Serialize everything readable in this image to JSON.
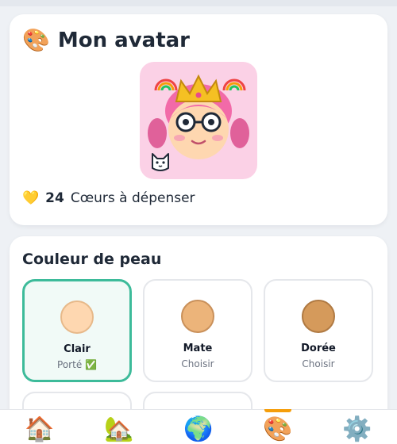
{
  "avatar_card": {
    "icon": "palette-icon",
    "icon_glyph": "🎨",
    "title": "Mon avatar",
    "hearts_icon": "yellow-heart-icon",
    "hearts_glyph": "💛",
    "hearts_count": "24",
    "hearts_label": "Cœurs à dépenser"
  },
  "skin_section": {
    "title": "Couleur de peau",
    "swatches": [
      {
        "name": "Clair",
        "status": "Porté ✅",
        "color": "#fed7b0",
        "border": "#e7b98a"
      },
      {
        "name": "Mate",
        "status": "Choisir",
        "color": "#ecb47a",
        "border": "#c9905a"
      },
      {
        "name": "Dorée",
        "status": "Choisir",
        "color": "#d59a5b",
        "border": "#b07a43"
      }
    ]
  },
  "nav": [
    {
      "icon": "house-icon",
      "glyph": "🏠"
    },
    {
      "icon": "house-garden-icon",
      "glyph": "🏡"
    },
    {
      "icon": "globe-icon",
      "glyph": "🌍"
    },
    {
      "icon": "palette-icon",
      "glyph": "🎨"
    },
    {
      "icon": "gear-icon",
      "glyph": "⚙️"
    }
  ],
  "colors": {
    "selected_border": "#3dbb9a",
    "avatar_bg": "#fbd1e6",
    "nav_active": "#f59e0b"
  }
}
